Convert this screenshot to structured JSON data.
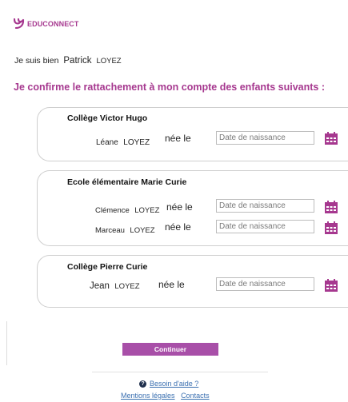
{
  "brand": {
    "name": "EDUCONNECT",
    "color": "#a6388f",
    "logo_icon": "educonnect-logo-icon"
  },
  "intro": {
    "text": "Je suis bien",
    "first_name": "Patrick",
    "last_name": "LOYEZ"
  },
  "confirm_text": "Je confirme le rattachement à mon compte des enfants suivants :",
  "schools": [
    {
      "name": "Collège Victor Hugo",
      "children": [
        {
          "first_name": "Léane",
          "last_name": "LOYEZ",
          "born_label": "née le",
          "date_placeholder": "Date de naissance"
        }
      ]
    },
    {
      "name": "Ecole élémentaire  Marie Curie",
      "children": [
        {
          "first_name": "Clémence",
          "last_name": "LOYEZ",
          "born_label": "née le",
          "date_placeholder": "Date de naissance"
        },
        {
          "first_name": "Marceau",
          "last_name": "LOYEZ",
          "born_label": "née le",
          "date_placeholder": "Date de naissance"
        }
      ]
    },
    {
      "name": "Collège  Pierre Curie",
      "children": [
        {
          "first_name": "Jean",
          "last_name": "LOYEZ",
          "born_label": "née le",
          "date_placeholder": "Date de naissance"
        }
      ]
    }
  ],
  "continue_button": {
    "label": "Continuer",
    "color": "#a84fa8"
  },
  "footer": {
    "help_label": "Besoin d'aide ?",
    "legal_label": "Mentions légales",
    "contacts_label": "Contacts",
    "link_color": "#3a6fb0"
  },
  "icons": {
    "calendar": "calendar-icon",
    "help": "question-circle-icon"
  }
}
